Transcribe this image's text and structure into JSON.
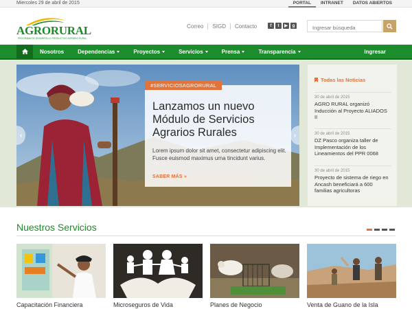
{
  "topbar": {
    "date": "Miercoles 29 de abril de 2015",
    "links": [
      "PORTAL",
      "INTRANET",
      "DATOS ABIERTOS"
    ]
  },
  "header": {
    "logo_text": "AGRORURAL",
    "logo_tagline": "PROGRAMA DE DESARROLLO PRODUCTIVO AGRARIO RURAL",
    "links": [
      "Correo",
      "SIGD",
      "Contacto"
    ],
    "social_icons": [
      "facebook-icon",
      "twitter-icon",
      "youtube-icon",
      "google-plus-icon"
    ],
    "search_placeholder": "Ingresar búsqueda"
  },
  "nav": {
    "items": [
      {
        "label": "Nosotros",
        "dropdown": false
      },
      {
        "label": "Dependencias",
        "dropdown": true
      },
      {
        "label": "Proyectos",
        "dropdown": true
      },
      {
        "label": "Servicios",
        "dropdown": true
      },
      {
        "label": "Prensa",
        "dropdown": true
      },
      {
        "label": "Transparencia",
        "dropdown": true
      }
    ],
    "login": "Ingresar"
  },
  "slide": {
    "tag": "#SERVICIOSAGRORURAL",
    "title": "Lanzamos un nuevo Módulo de Servicios Agrarios Rurales",
    "description": "Lorem ipsum dolor sit amet, consectetur adipiscing elit. Fusce euismod maximus urna tincidunt varius.",
    "more": "SABER MÁS »"
  },
  "news": {
    "heading": "Todas las Noticias",
    "items": [
      {
        "date": "30 de abril de 2015",
        "title": "AGRO RURAL organizó Inducción al Proyecto ALIADOS II"
      },
      {
        "date": "30 de abril de 2015",
        "title": "DZ Pasco organiza taller de Implementación de los Lineamientos del PPR 0068"
      },
      {
        "date": "30 de abril de 2015",
        "title": "Proyecto de sistema de riego en Ancash beneficiará a 600 familias agricultoras"
      }
    ]
  },
  "services": {
    "heading": "Nuestros Servicios",
    "cards": [
      "Capacitación Financiera",
      "Microseguros de Vida",
      "Planes de Negocio",
      "Venta de Guano de la Isla"
    ]
  },
  "colors": {
    "brand_green": "#1c8c2c",
    "accent_orange": "#e2733b",
    "search_button": "#c9a26a"
  }
}
